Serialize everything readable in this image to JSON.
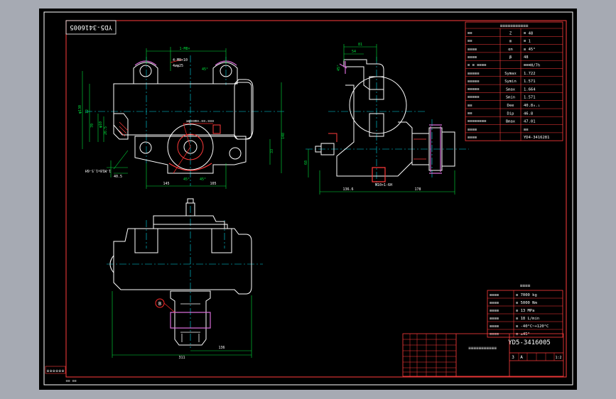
{
  "window": {
    "background": "#a6aab3",
    "canvas_color": "#000000",
    "frame_color": "#ff3b3b",
    "border_color": "#ffffff"
  },
  "palette": {
    "outline": "#ffffff",
    "centerline": "#00d7e6",
    "dimension": "#00e23c",
    "hatch": "#ff3b3b",
    "highlight": "#d66bd6",
    "leader": "#ff2a2a",
    "table_line": "#ff3b3b",
    "table_text": "#ffffff"
  },
  "drawing": {
    "part_code_rotated": "YD5-3416005",
    "stamp_text": "※※※※※※",
    "stamp_small": "≡≡ ≡≡",
    "front_view": {
      "dims": {
        "top_span": "1-M8×",
        "top_hole": "4-M8×10",
        "top_hole2": "4∅φ25",
        "angle_right": "45°",
        "left_height": "φ130",
        "left_offset": "12",
        "left_mid": "70",
        "left_inner": "φ10",
        "left_lower": "26.5",
        "right_height": "148",
        "right_mid": "33",
        "bottom_left": "145",
        "bottom_right": "105",
        "bottom_angle_left": "45°",
        "bottom_angle_right": "45°",
        "bottom_offset": "40.5",
        "leader_note": "≥φ≡≡m≡.≡≡.≡≡≡",
        "bolt_note": "1-M18×1.5-6H"
      }
    },
    "side_view": {
      "dims": {
        "top_dim": "81",
        "top_dim2": "54",
        "left_angle": "45°",
        "left_height": "68",
        "bottom_left": "136.6",
        "bottom_right": "178",
        "bottom_note": "M10×1-6H"
      }
    },
    "top_view": {
      "dims": {
        "bottom_left": "311",
        "bottom_right": "136",
        "balloon": "B"
      }
    }
  },
  "params_table": {
    "title": "≡≡≡≡≡≡≡≡≡≡≡",
    "rows": [
      {
        "name": "≡≡",
        "sym": "Z",
        "val": "≡   48"
      },
      {
        "name": "≡≡",
        "sym": "m",
        "val": "≡   1"
      },
      {
        "name": "≡≡≡≡",
        "sym": "αn",
        "val": "≡   45°"
      },
      {
        "name": "≡≡≡≡",
        "sym": "β",
        "val": "48"
      },
      {
        "name": "≡ ≡ ≡≡≡≡",
        "sym": "",
        "val": "≡≡≡H/7h"
      },
      {
        "name": "≡≡≡≡≡",
        "sym": "Symax",
        "val": "1.722"
      },
      {
        "name": "≡≡≡≡≡",
        "sym": "Symin",
        "val": "1.571"
      },
      {
        "name": "≡≡≡≡≡",
        "sym": "Smax",
        "val": "1.664"
      },
      {
        "name": "≡≡≡≡≡",
        "sym": "Smin",
        "val": "1.571"
      },
      {
        "name": "≡≡",
        "sym": "Dee",
        "val": "40.8₀.₁"
      },
      {
        "name": "≡≡",
        "sym": "Dip",
        "val": "46.8"
      },
      {
        "name": "≡≡≡≡≡≡≡≡",
        "sym": "Bmax",
        "val": "47.01"
      },
      {
        "name": "≡≡≡≡",
        "sym": "",
        "val": "≡≡"
      },
      {
        "name": "≡≡≡≡",
        "sym": "",
        "val": "YD4-3416281"
      }
    ]
  },
  "perf_table": {
    "title": "≡≡≡≡",
    "rows": [
      {
        "name": "≡≡≡≡",
        "val": "≡  7000  kg"
      },
      {
        "name": "≡≡≡≡",
        "val": "≡  5000  Nm"
      },
      {
        "name": "≡≡≡≡",
        "val": "≡  13     MPa"
      },
      {
        "name": "≡≡≡≡",
        "val": "≡  18     L/min"
      },
      {
        "name": "≡≡≡≡",
        "val": "≡  -40°C~+120°C"
      },
      {
        "name": "≡≡≡≡",
        "val": "≡  ±45°"
      }
    ]
  },
  "title_block": {
    "drawing_no": "YD5-3416005",
    "name": "≡≡≡≡≡≡≡≡≡≡≡",
    "scale_a": "3",
    "scale_b": "A",
    "sheet": "1",
    "sheets": "1",
    "k": "1:2"
  }
}
